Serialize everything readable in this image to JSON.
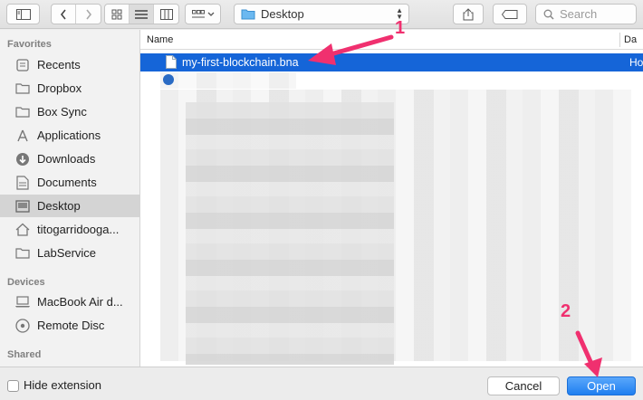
{
  "toolbar": {
    "path_label": "Desktop",
    "search_placeholder": "Search"
  },
  "sidebar": {
    "sections": [
      "Favorites",
      "Devices",
      "Shared"
    ],
    "favorites": [
      {
        "label": "Recents",
        "icon": "recents-icon"
      },
      {
        "label": "Dropbox",
        "icon": "folder-icon"
      },
      {
        "label": "Box Sync",
        "icon": "folder-icon"
      },
      {
        "label": "Applications",
        "icon": "applications-icon"
      },
      {
        "label": "Downloads",
        "icon": "downloads-icon"
      },
      {
        "label": "Documents",
        "icon": "documents-icon"
      },
      {
        "label": "Desktop",
        "icon": "desktop-icon",
        "selected": true
      },
      {
        "label": "titogarridooga...",
        "icon": "home-icon"
      },
      {
        "label": "LabService",
        "icon": "folder-icon"
      }
    ],
    "devices": [
      {
        "label": "MacBook Air d...",
        "icon": "laptop-icon"
      },
      {
        "label": "Remote Disc",
        "icon": "disc-icon"
      }
    ]
  },
  "file_list": {
    "column_name": "Name",
    "column_date": "Da",
    "rows": [
      {
        "name": "my-first-blockchain.bna",
        "date": "Ho",
        "selected": true
      }
    ]
  },
  "bottom": {
    "hide_extension_label": "Hide extension",
    "cancel_label": "Cancel",
    "open_label": "Open"
  },
  "annotations": {
    "step1": "1",
    "step2": "2",
    "color": "#f0306f"
  },
  "colors": {
    "selection": "#1565d8",
    "accent_button": "#1f7ff0"
  }
}
